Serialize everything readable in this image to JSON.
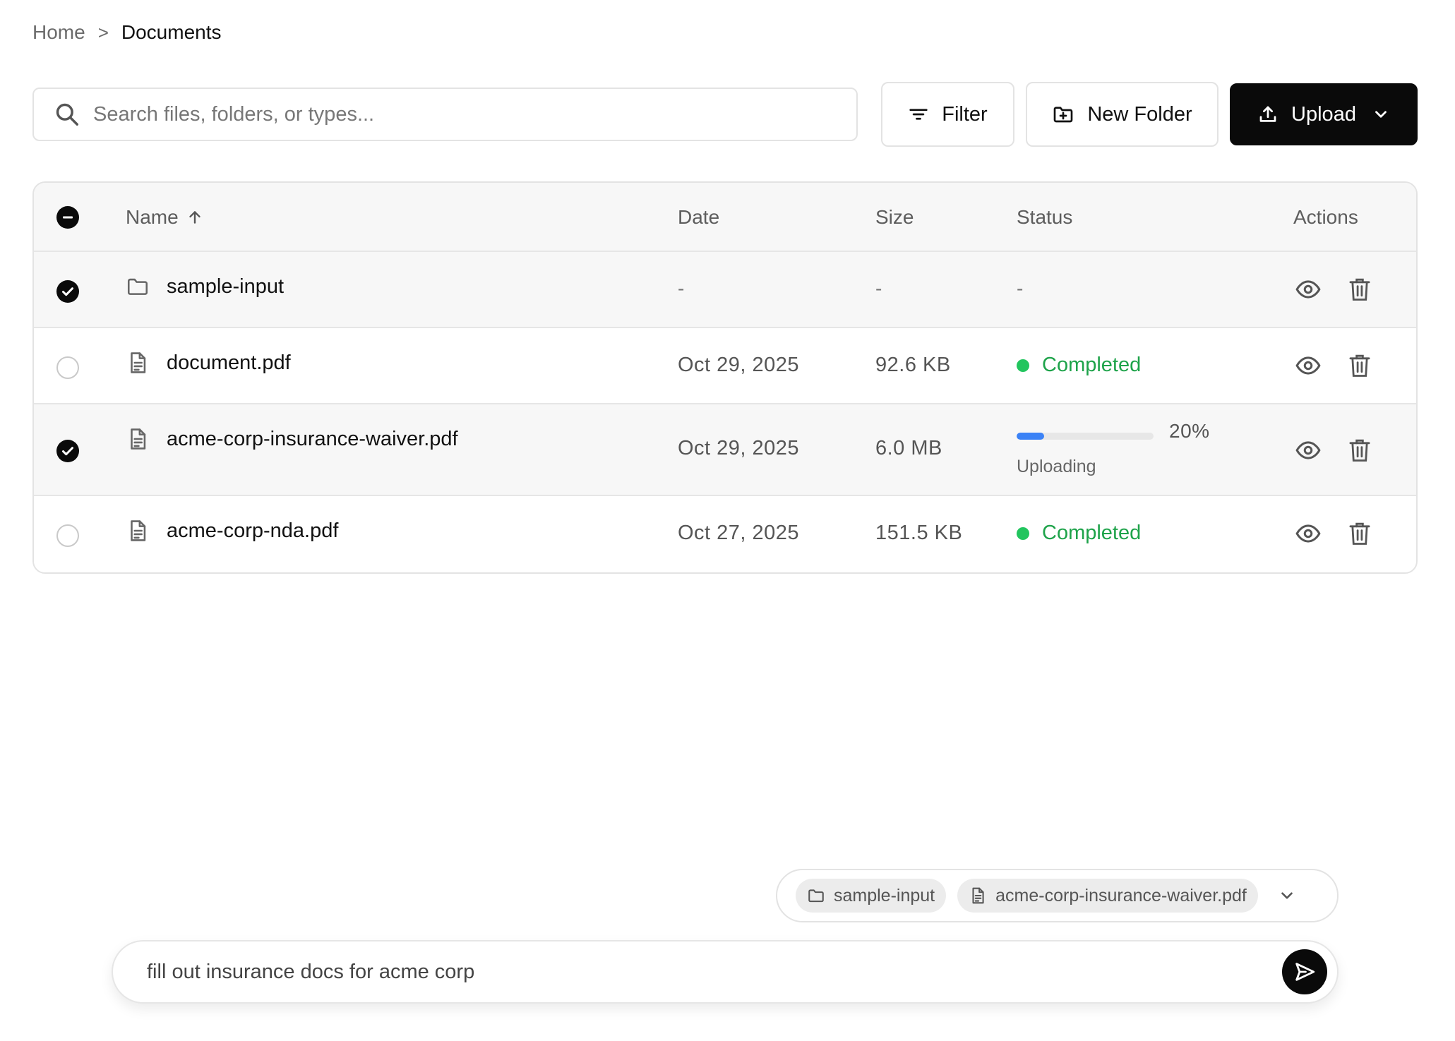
{
  "breadcrumb": {
    "home": "Home",
    "separator": ">",
    "current": "Documents"
  },
  "search": {
    "placeholder": "Search files, folders, or types...",
    "value": ""
  },
  "toolbar": {
    "filter_label": "Filter",
    "new_folder_label": "New Folder",
    "upload_label": "Upload"
  },
  "table": {
    "columns": {
      "name": "Name",
      "date": "Date",
      "size": "Size",
      "status": "Status",
      "actions": "Actions"
    },
    "sort": {
      "column": "Name",
      "direction": "ascending"
    },
    "header_checkbox": "indeterminate",
    "rows": [
      {
        "name": "sample-input",
        "type": "folder",
        "date": "-",
        "size": "-",
        "status": "-",
        "selected": true
      },
      {
        "name": "document.pdf",
        "type": "file",
        "date": "Oct 29, 2025",
        "size": "92.6 KB",
        "status": "Completed",
        "selected": false
      },
      {
        "name": "acme-corp-insurance-waiver.pdf",
        "type": "file",
        "date": "Oct 29, 2025",
        "size": "6.0 MB",
        "status": "Uploading",
        "progress_label": "20%",
        "progress": 0.2,
        "selected": true
      },
      {
        "name": "acme-corp-nda.pdf",
        "type": "file",
        "date": "Oct 27, 2025",
        "size": "151.5 KB",
        "status": "Completed",
        "selected": false
      }
    ]
  },
  "context_chips": [
    {
      "label": "sample-input",
      "icon": "folder-icon"
    },
    {
      "label": "acme-corp-insurance-waiver.pdf",
      "icon": "file-icon"
    }
  ],
  "prompt": {
    "value": "fill out insurance docs for acme corp"
  },
  "colors": {
    "accent": "#0a0a0a",
    "completed": "#1ea34a",
    "completed_dot": "#22c55e",
    "progress": "#3b82f6"
  }
}
